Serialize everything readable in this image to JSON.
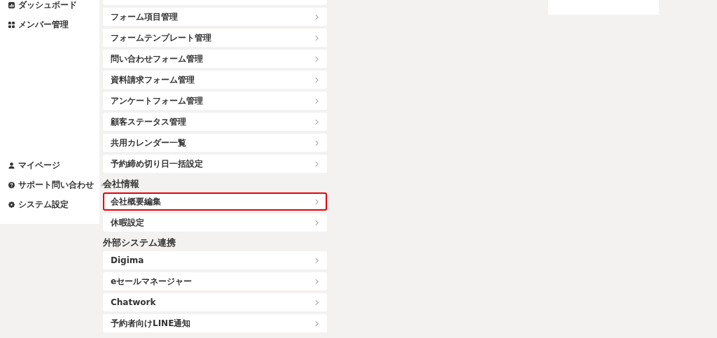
{
  "sidebar": {
    "top_items": [
      {
        "label": "ダッシュボード"
      },
      {
        "label": "メンバー管理"
      }
    ],
    "bottom_items": [
      {
        "label": "マイページ"
      },
      {
        "label": "サポート問い合わせ",
        "submenu_arrow": "›"
      },
      {
        "label": "システム設定"
      }
    ]
  },
  "groups": [
    {
      "items": [
        {
          "label": "フォーム項目管理",
          "highlighted": false
        },
        {
          "label": "フォームテンプレート管理",
          "highlighted": false
        },
        {
          "label": "問い合わせフォーム管理",
          "highlighted": false
        },
        {
          "label": "資料請求フォーム管理",
          "highlighted": false
        },
        {
          "label": "アンケートフォーム管理",
          "highlighted": false
        },
        {
          "label": "顧客ステータス管理",
          "highlighted": false
        },
        {
          "label": "共用カレンダー一覧",
          "highlighted": false
        },
        {
          "label": "予約締め切り日一括設定",
          "highlighted": false
        }
      ]
    },
    {
      "heading": "会社情報",
      "items": [
        {
          "label": "会社概要編集",
          "highlighted": true
        },
        {
          "label": "休暇設定",
          "highlighted": false
        }
      ]
    },
    {
      "heading": "外部システム連携",
      "items": [
        {
          "label": "Digima",
          "highlighted": false
        },
        {
          "label": "eセールマネージャー",
          "highlighted": false
        },
        {
          "label": "Chatwork",
          "highlighted": false
        },
        {
          "label": "予約者向けLINE通知",
          "highlighted": false
        }
      ]
    }
  ]
}
